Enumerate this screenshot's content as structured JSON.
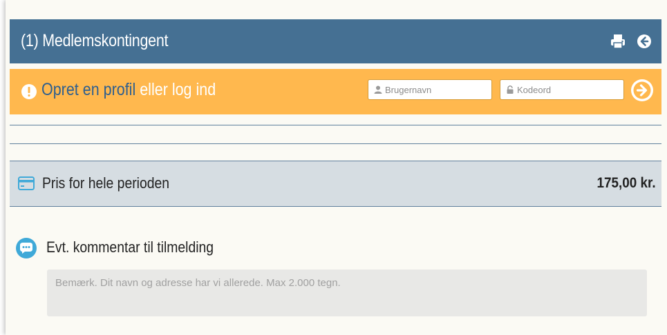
{
  "header": {
    "title": "(1) Medlemskontingent",
    "print_icon": "print-icon",
    "back_icon": "circle-arrow-left-icon"
  },
  "notice": {
    "icon": "exclamation-circle-icon",
    "create_profile_text": "Opret en profil",
    "or_login_text": "eller log ind",
    "username_placeholder": "Brugernavn",
    "password_placeholder": "Kodeord",
    "submit_icon": "circle-arrow-right-icon"
  },
  "price": {
    "icon": "credit-card-icon",
    "label": "Pris for hele perioden",
    "value": "175,00 kr."
  },
  "comment": {
    "icon": "speech-bubble-icon",
    "label": "Evt. kommentar til tilmelding",
    "placeholder": "Bemærk. Dit navn og adresse har vi allerede. Max 2.000 tegn."
  },
  "colors": {
    "header_bg": "#457093",
    "notice_bg": "#ffb84e",
    "link_blue": "#2e5f8f",
    "price_bg": "#d6dde2",
    "accent_icon": "#3fa9d8"
  }
}
